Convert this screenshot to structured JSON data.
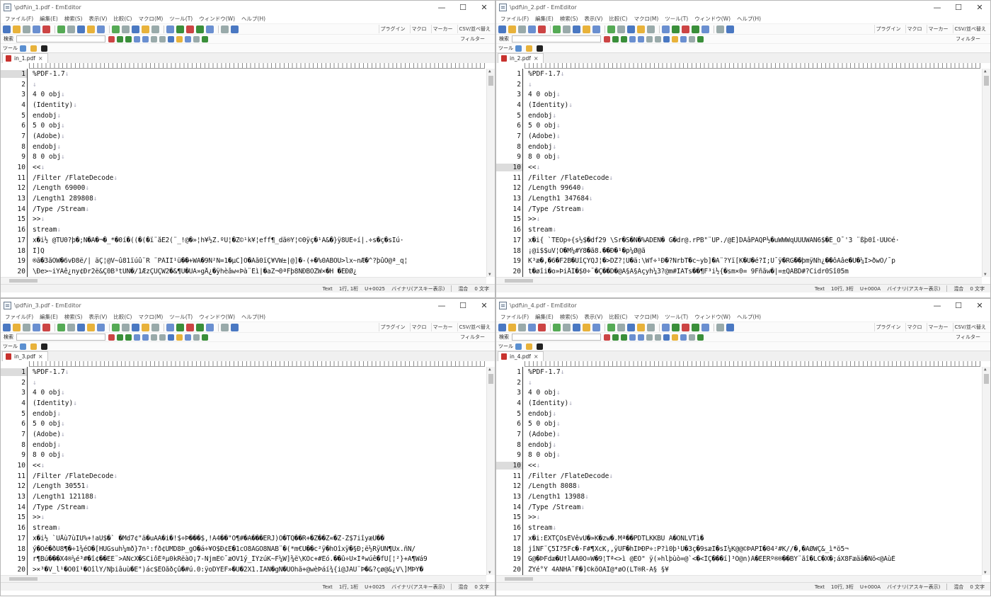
{
  "app": "EmEditor",
  "menu": [
    "ファイル(F)",
    "編集(E)",
    "検索(S)",
    "表示(V)",
    "比較(C)",
    "マクロ(M)",
    "ツール(T)",
    "ウィンドウ(W)",
    "ヘルプ(H)"
  ],
  "toolbar_right": [
    "プラグイン",
    "マクロ",
    "マーカー",
    "CSV/並べ替え"
  ],
  "search_label": "検索",
  "filter_label": "フィルター",
  "tools_label": "ツール",
  "windows": [
    {
      "title": "\\pdf\\in_1.pdf - EmEditor",
      "tab": "in_1.pdf",
      "current_line": 1,
      "lines": [
        {
          "n": "1",
          "t": "%PDF-1.7"
        },
        {
          "n": "2",
          "t": ""
        },
        {
          "n": "3",
          "t": "4 0 obj"
        },
        {
          "n": "4",
          "t": "(Identity)"
        },
        {
          "n": "5",
          "t": "endobj"
        },
        {
          "n": "6",
          "t": "5 0 obj"
        },
        {
          "n": "7",
          "t": "(Adobe)"
        },
        {
          "n": "8",
          "t": "endobj"
        },
        {
          "n": "9",
          "t": "8 0 obj"
        },
        {
          "n": "10",
          "t": "<<"
        },
        {
          "n": "11",
          "t": "/Filter /FlateDecode"
        },
        {
          "n": "12",
          "t": "/Length 69000"
        },
        {
          "n": "13",
          "t": "/Length1 289808"
        },
        {
          "n": "14",
          "t": "/Type /Stream"
        },
        {
          "n": "15",
          "t": ">>"
        },
        {
          "n": "16",
          "t": "stream"
        },
        {
          "n": "17",
          "t": "x�i½  @TU0?þ�;Ñ�Ã�¬�_*�0í�((�(�ï¨åÊ2(¨_!@�»¦h¥½Z.ºU¦�Z©¹k¥¦eff¶_dã®Y¦©0ÿç�¹Ã&�}ÿ8ÛÊ÷í|.÷s�ç�sÏú·",
          "bin": true
        },
        {
          "n": "18",
          "t": "Ï]Q",
          "bin": true
        },
        {
          "n": "19",
          "t": "®ã�3ãÔW�6vÐ8ë/|  äÇ¦@V~û81ïúû¨R ¨PÂÎÏ¹ü��+WA�9Ñ²Ñ=1�µC]Ó�Ãã0ïÇ¥VW±|@]�-(+�%0ÃBOU>lx~nÆ�^?þûÒ@ª_q¦",
          "bin": true
        },
        {
          "n": "20",
          "t": "\\Ðe>~iYAê¿ny¢Ðr2ë&Ç0B³tÙN�/1ÆzÇÜÇW2�&¶Ù�ÙÄ»gÅ¿�ÿhèâw«Þà¨Êì|�aZ¬0ªFþ8ÑÐBÖZW×�H �ÉÐØ¿",
          "bin": true
        }
      ],
      "status": {
        "mode": "Text",
        "pos": "1行, 1桁",
        "code": "U+0025",
        "enc": "バイナリ(アスキー表示)",
        "sel": "混合",
        "chars": "0 文字"
      }
    },
    {
      "title": "\\pdf\\in_2.pdf - EmEditor",
      "tab": "in_2.pdf",
      "current_line": 10,
      "lines": [
        {
          "n": "1",
          "t": "%PDF-1.7"
        },
        {
          "n": "2",
          "t": ""
        },
        {
          "n": "3",
          "t": "4 0 obj"
        },
        {
          "n": "4",
          "t": "(Identity)"
        },
        {
          "n": "5",
          "t": "endobj"
        },
        {
          "n": "6",
          "t": "5 0 obj"
        },
        {
          "n": "7",
          "t": "(Adobe)"
        },
        {
          "n": "8",
          "t": "endobj"
        },
        {
          "n": "9",
          "t": "8 0 obj"
        },
        {
          "n": "10",
          "t": "<<"
        },
        {
          "n": "11",
          "t": "/Filter /FlateDecode"
        },
        {
          "n": "12",
          "t": "/Length 99640"
        },
        {
          "n": "13",
          "t": "/Length1 347684"
        },
        {
          "n": "14",
          "t": "/Type /Stream"
        },
        {
          "n": "15",
          "t": ">>"
        },
        {
          "n": "16",
          "t": "stream"
        },
        {
          "n": "17",
          "t": "x�i{  `TEÒp÷{s½$�df29 \\Sr�S�Ñ�%ADEÑ� G�dr@.rPB\"¨ÜP./@E]DÃâPAQP½�uWWWqUUUWAÑ6$�É_Õ¯'3  ¨ßþ0î·ÛU©é·",
          "bin": true
        },
        {
          "n": "18",
          "t": "¡@i$$uV¦Ô�M¼#Ý8�ã8.��Ð�¹�p¼Ø@ã",
          "bin": true
        },
        {
          "n": "19",
          "t": "K³æ�,�6�F2B�ÚîÇYQJ¦�>DZ?¦Ü�ä:\\Wf÷¹Ð�?ÑrbT�c~yb]�Ä¨?Yï[K�U�é?Î;Ü¯ÿ�RG��þmÿÑh¿��ôAâe�U�¼I>ðwÔ/¯p",
          "bin": true
        },
        {
          "n": "20",
          "t": "t�øîi�o»ÞiÅÍ�$0÷¯�Ç��D�@Ã§Ã§Àçyh¼3?@m#IÃTs��¶F³i½{�sm×0= 9Fñãw�|=±QABD#?Cidr0Sî05m",
          "bin": true
        }
      ],
      "status": {
        "mode": "Text",
        "pos": "10行, 3桁",
        "code": "U+000A",
        "enc": "バイナリ(アスキー表示)",
        "sel": "混合",
        "chars": "0 文字"
      }
    },
    {
      "title": "\\pdf\\in_3.pdf - EmEditor",
      "tab": "in_3.pdf",
      "current_line": 1,
      "lines": [
        {
          "n": "1",
          "t": "%PDF-1.7"
        },
        {
          "n": "2",
          "t": ""
        },
        {
          "n": "3",
          "t": "4 0 obj"
        },
        {
          "n": "4",
          "t": "(Identity)"
        },
        {
          "n": "5",
          "t": "endobj"
        },
        {
          "n": "6",
          "t": "5 0 obj"
        },
        {
          "n": "7",
          "t": "(Adobe)"
        },
        {
          "n": "8",
          "t": "endobj"
        },
        {
          "n": "9",
          "t": "8 0 obj"
        },
        {
          "n": "10",
          "t": "<<"
        },
        {
          "n": "11",
          "t": "/Filter /FlateDecode"
        },
        {
          "n": "12",
          "t": "/Length 30551"
        },
        {
          "n": "13",
          "t": "/Length1 121188"
        },
        {
          "n": "14",
          "t": "/Type /Stream"
        },
        {
          "n": "15",
          "t": ">>"
        },
        {
          "n": "16",
          "t": "stream"
        },
        {
          "n": "17",
          "t": "x�i½  `UÅù7ùÌÛ%+!aU$�` �Md7¢\"ä�uAÀ�i�!$÷Þ���$,!Ã4��\"Ó¶#�A���ËRJ)Ò�TQ��R+�Z��Z«�Z-Z$7iîyæÙ��",
          "bin": true
        },
        {
          "n": "18",
          "t": "ý�Ôé�ðÜ8¶�÷1¾éÔ�[HUGsuh¼mð}7n¹:fð¢UMD8Þ_gÒ�á÷¥Ö$Ð¢Ë�1cÔ8ÂGÖ8ÑAB¨�(*m€Ü��c²ÿ�hÒîxÿ�§Ð;ë½RÿÜÑ¶Ùx.ñN/",
          "bin": true
        },
        {
          "n": "19",
          "t": "r¶Bú���X4®¼é³#�î¢��EE¨>ÃÑcX�SCiôÉªµ0kRëàÖ¡7-NjmE©¯æÔV1ý_ÎÝzúK~F¼W]¾ë\\KÒc+#Éó.��û÷Ü×Íªwúê�fU[¦²}+Ã¶Wá9",
          "bin": true
        },
        {
          "n": "20",
          "t": ">×³�V_l¹�Ô0î¹�ÕîlY/Ñþiâuù�E\")ác$ÉÔãðçû�#ú.0:ÿoDYÉF»�Ù�2X1.ÎÃÑ�gÑ�ÜÖhã+@wèÞáí¾{i@JAU¨Þ�&?çø@&¿V\\]MÞY�",
          "bin": true
        }
      ],
      "status": {
        "mode": "Text",
        "pos": "1行, 1桁",
        "code": "U+0025",
        "enc": "バイナリ(アスキー表示)",
        "sel": "混合",
        "chars": "0 文字"
      }
    },
    {
      "title": "\\pdf\\in_4.pdf - EmEditor",
      "tab": "in_4.pdf",
      "current_line": 10,
      "lines": [
        {
          "n": "1",
          "t": "%PDF-1.7"
        },
        {
          "n": "2",
          "t": ""
        },
        {
          "n": "3",
          "t": "4 0 obj"
        },
        {
          "n": "4",
          "t": "(Identity)"
        },
        {
          "n": "5",
          "t": "endobj"
        },
        {
          "n": "6",
          "t": "5 0 obj"
        },
        {
          "n": "7",
          "t": "(Adobe)"
        },
        {
          "n": "8",
          "t": "endobj"
        },
        {
          "n": "9",
          "t": "8 0 obj"
        },
        {
          "n": "10",
          "t": "<<"
        },
        {
          "n": "11",
          "t": "/Filter /FlateDecode"
        },
        {
          "n": "12",
          "t": "/Length 8088"
        },
        {
          "n": "13",
          "t": "/Length1 13988"
        },
        {
          "n": "14",
          "t": "/Type /Stream"
        },
        {
          "n": "15",
          "t": ">>"
        },
        {
          "n": "16",
          "t": "stream"
        },
        {
          "n": "17",
          "t": "x�i:EXTÇÒsÉVêvÛ�»K�zw�.Mª��PDTLKKBÜ  Ã�ONLVTì�",
          "bin": true
        },
        {
          "n": "18",
          "t": "jîÑF¨Ç5Î?5Fc�·F#¶XcK,,ÿÜF�hIÞÐP÷:P?ì0þ¹Û�3ç�9sæÏ�sÏ¼K@@©ÞÄPÏ�04²#K//�,�AØWÇ&_ì*ö5¬",
          "bin": true
        },
        {
          "n": "19",
          "t": "G@�ÞFdæ�U†lAA0Ö¤W�9¦Tª<>ì @EÕ\" ÿ(»hlþùò=@`<�<ÎÇ���í]³Õ@n)Â�ÈÉRº®®��BY¨ãî�LC�X�;áX8Fæää�Nö<@AùÈ",
          "bin": true
        },
        {
          "n": "20",
          "t": "ZYé°Ý 4AÑHA¨F�]©kõÕÃÎ@*øÖ(LT®R-Ã§ §¥",
          "bin": true
        }
      ],
      "status": {
        "mode": "Text",
        "pos": "10行, 3桁",
        "code": "U+000A",
        "enc": "バイナリ(アスキー表示)",
        "sel": "混合",
        "chars": "0 文字"
      }
    }
  ]
}
